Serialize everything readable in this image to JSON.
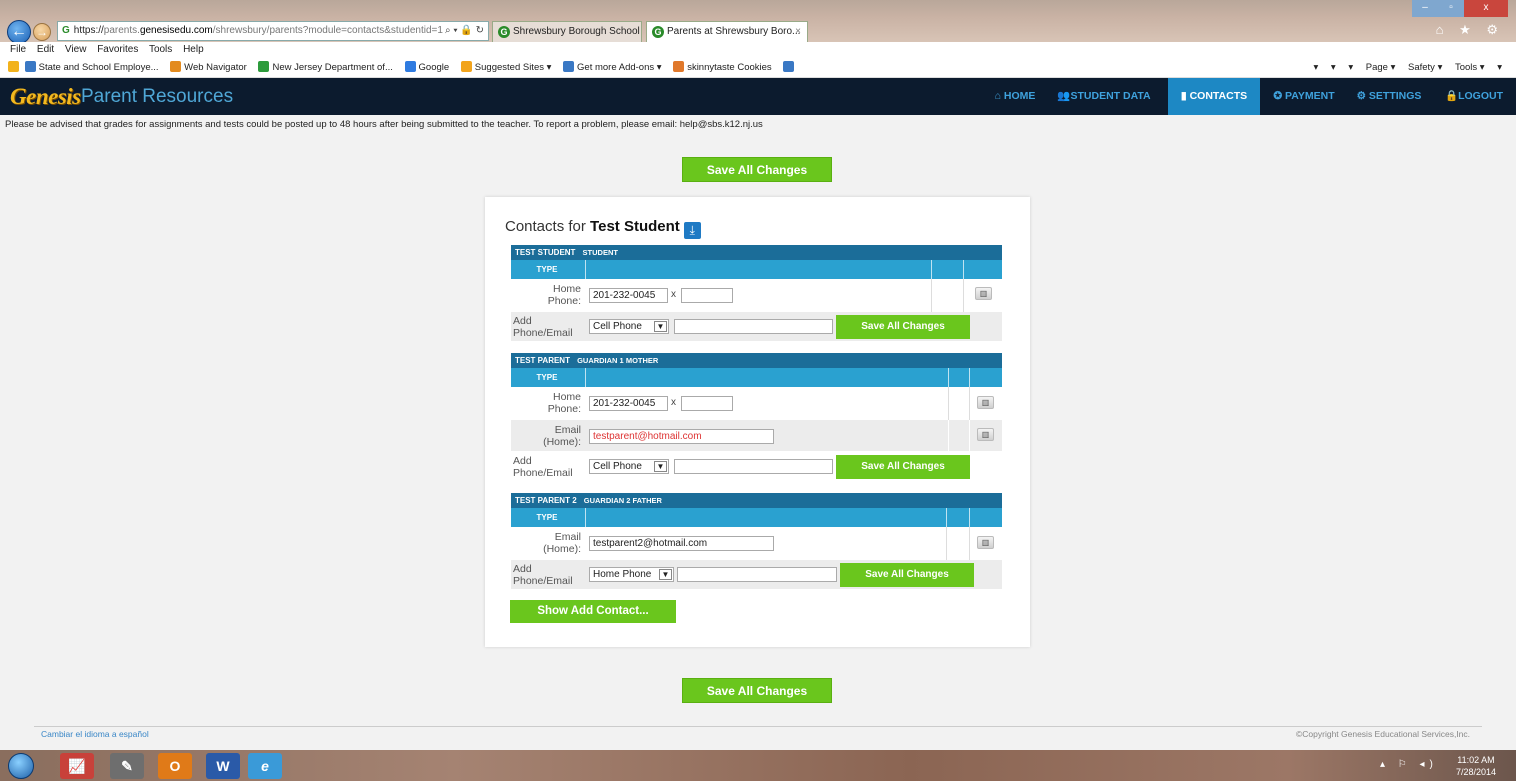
{
  "browser": {
    "address": {
      "scheme": "https://",
      "pre": "parents.",
      "domain": "genesisedu.com",
      "path": "/shrewsbury/parents?module=contacts&studentid=1",
      "icons": "⌕ ▾ 🔒 ↻"
    },
    "tabs": [
      {
        "label": "Shrewsbury Borough School"
      },
      {
        "label": "Parents at Shrewsbury Boro...",
        "close": "×"
      }
    ],
    "window_controls": {
      "minimize": "–",
      "maximize": "▫",
      "close": "x"
    },
    "toolbar_icons": "⌂ ★ ⚙",
    "menu": [
      "File",
      "Edit",
      "View",
      "Favorites",
      "Tools",
      "Help"
    ],
    "favorites": [
      {
        "label": "State and School Employe...",
        "color": "#3a78c4"
      },
      {
        "label": "Web Navigator",
        "color": "#e38b1f"
      },
      {
        "label": "New Jersey Department of...",
        "color": "#2d9b3c"
      },
      {
        "label": "Google",
        "color": "#2f7be0"
      },
      {
        "label": "Suggested Sites ▾",
        "color": "#f2a41c"
      },
      {
        "label": "Get more Add-ons ▾",
        "color": "#3a78c4"
      },
      {
        "label": "skinnytaste Cookies",
        "color": "#e0782b"
      }
    ],
    "command_bar": [
      "▾",
      "▾",
      "▾",
      "Page ▾",
      "Safety ▾",
      "Tools ▾",
      "▾"
    ]
  },
  "app": {
    "logo": "Genesis",
    "title": "Parent Resources",
    "nav": [
      {
        "label": "⌂ HOME"
      },
      {
        "label": "👥STUDENT DATA"
      },
      {
        "label": "▮ CONTACTS",
        "active": true
      },
      {
        "label": "✪ PAYMENT"
      },
      {
        "label": "⚙ SETTINGS"
      },
      {
        "label": "🔒LOGOUT"
      }
    ],
    "advisory": "Please be advised that grades for assignments and tests could be posted up to 48 hours after being submitted to the teacher. To report a problem, please email: help@sbs.k12.nj.us"
  },
  "page": {
    "save_all_label": "Save All Changes",
    "heading_prefix": "Contacts for ",
    "heading_student": "Test Student",
    "type_label": "TYPE",
    "add_label_1": "Add",
    "add_label_2": "Phone/Email",
    "x_label": "x",
    "show_add_contact": "Show Add Contact...",
    "contacts": [
      {
        "name": "TEST STUDENT",
        "roles": "STUDENT",
        "rows": [
          {
            "label_1": "Home",
            "label_2": "Phone:",
            "value": "201-232-0045",
            "ext": ""
          }
        ],
        "add_select": "Cell Phone",
        "add_value": ""
      },
      {
        "name": "TEST PARENT",
        "roles": "GUARDIAN 1   MOTHER",
        "rows": [
          {
            "label_1": "Home",
            "label_2": "Phone:",
            "value": "201-232-0045",
            "ext": ""
          },
          {
            "label_1": "Email",
            "label_2": "(Home):",
            "value": "testparent@hotmail.com"
          }
        ],
        "add_select": "Cell Phone",
        "add_value": ""
      },
      {
        "name": "TEST PARENT 2",
        "roles": "GUARDIAN 2   FATHER",
        "rows": [
          {
            "label_1": "Email",
            "label_2": "(Home):",
            "value": "testparent2@hotmail.com"
          }
        ],
        "add_select": "Home Phone",
        "add_value": ""
      }
    ]
  },
  "footer": {
    "language_link": "Cambiar el idioma a español",
    "copyright": "©Copyright Genesis Educational Services,Inc."
  },
  "taskbar": {
    "apps": [
      {
        "name": "excel-icon",
        "glyph": "📈",
        "color": "#c8413a"
      },
      {
        "name": "snipping-tool-icon",
        "glyph": "✎",
        "color": "#6e6e6e"
      },
      {
        "name": "outlook-icon",
        "glyph": "O",
        "color": "#e07a18"
      },
      {
        "name": "word-icon",
        "glyph": "W",
        "color": "#2a5aa8"
      },
      {
        "name": "internet-explorer-icon",
        "glyph": "e",
        "color": "#3a9ad8"
      }
    ],
    "time": "11:02 AM",
    "date": "7/28/2014",
    "tray": "▴ ⚐ ◂)"
  },
  "colors": {
    "accent_green": "#6ac61d",
    "header_dark": "#0c1b2e",
    "nav_active": "#1d88c4",
    "table_head": "#1b6d99",
    "type_row": "#2aa1d0"
  }
}
